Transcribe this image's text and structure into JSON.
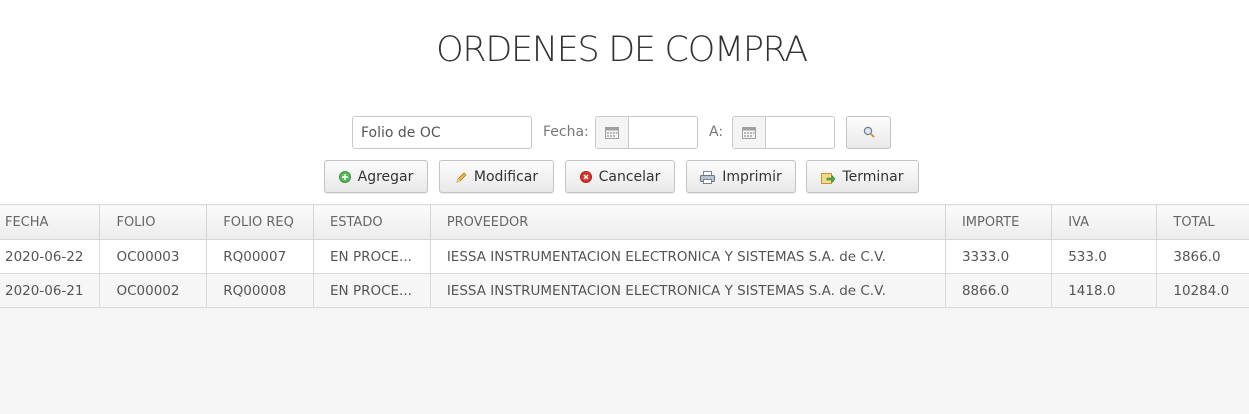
{
  "page": {
    "title": "ORDENES DE COMPRA"
  },
  "filters": {
    "folio_placeholder": "Folio de OC",
    "fecha_label": "Fecha:",
    "a_label": "A:",
    "fecha_desde_value": "",
    "fecha_hasta_value": ""
  },
  "toolbar": {
    "agregar": "Agregar",
    "modificar": "Modificar",
    "cancelar": "Cancelar",
    "imprimir": "Imprimir",
    "terminar": "Terminar"
  },
  "table": {
    "headers": [
      "FECHA",
      "FOLIO",
      "FOLIO REQ",
      "ESTADO",
      "PROVEEDOR",
      "IMPORTE",
      "IVA",
      "TOTAL"
    ],
    "rows": [
      [
        "2020-06-22",
        "OC00003",
        "RQ00007",
        "EN PROCE...",
        "IESSA INSTRUMENTACION ELECTRONICA Y SISTEMAS S.A. de C.V.",
        "3333.0",
        "533.0",
        "3866.0"
      ],
      [
        "2020-06-21",
        "OC00002",
        "RQ00008",
        "EN PROCE...",
        "IESSA INSTRUMENTACION ELECTRONICA Y SISTEMAS S.A. de C.V.",
        "8866.0",
        "1418.0",
        "10284.0"
      ]
    ]
  },
  "colors": {
    "add_green": "#5cb85c",
    "cancel_red": "#d9342b",
    "edit_orange": "#e8a23a"
  }
}
